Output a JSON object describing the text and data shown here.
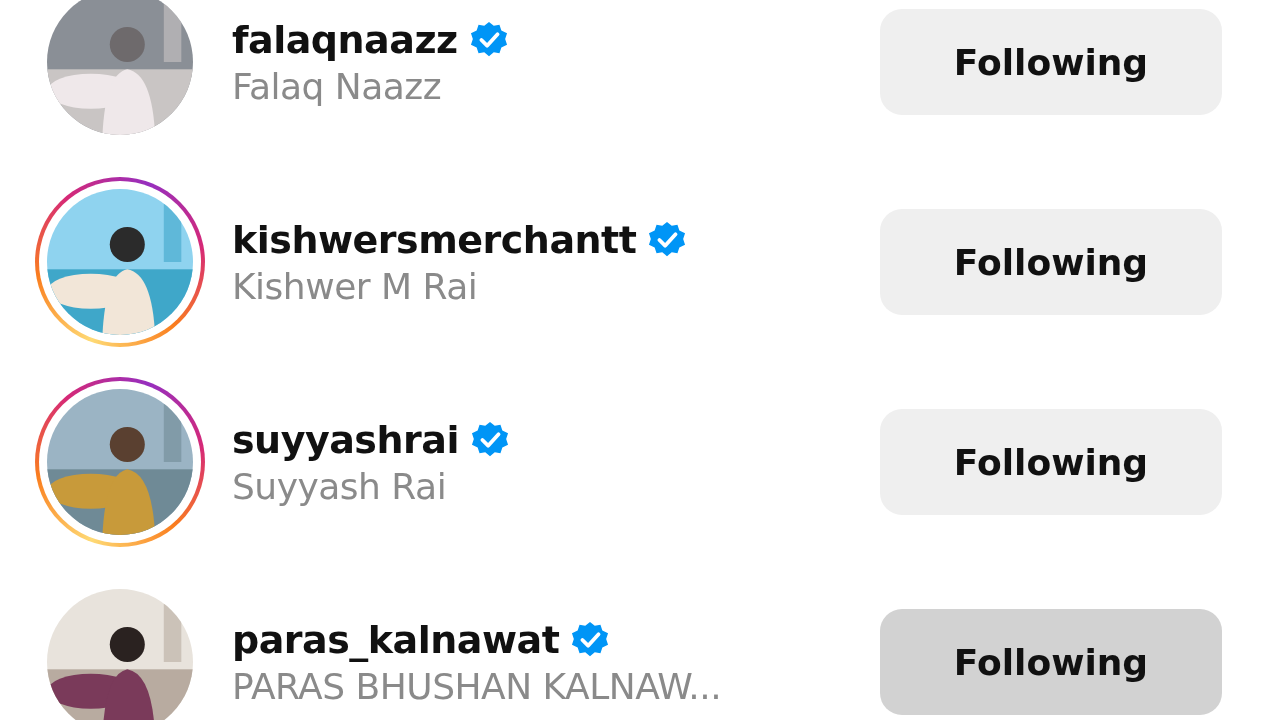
{
  "accounts": [
    {
      "username": "falaqnaazz",
      "verified": true,
      "full_name": "Falaq Naazz",
      "has_story": false,
      "button": {
        "label": "Following",
        "hovered": false
      }
    },
    {
      "username": "kishwersmerchantt",
      "verified": true,
      "full_name": "Kishwer M Rai",
      "has_story": true,
      "button": {
        "label": "Following",
        "hovered": false
      }
    },
    {
      "username": "suyyashrai",
      "verified": true,
      "full_name": "Suyyash Rai",
      "has_story": true,
      "button": {
        "label": "Following",
        "hovered": false
      }
    },
    {
      "username": "paras_kalnawat",
      "verified": true,
      "full_name": "PARAS BHUSHAN KALNAW...",
      "has_story": false,
      "button": {
        "label": "Following",
        "hovered": true
      }
    }
  ]
}
